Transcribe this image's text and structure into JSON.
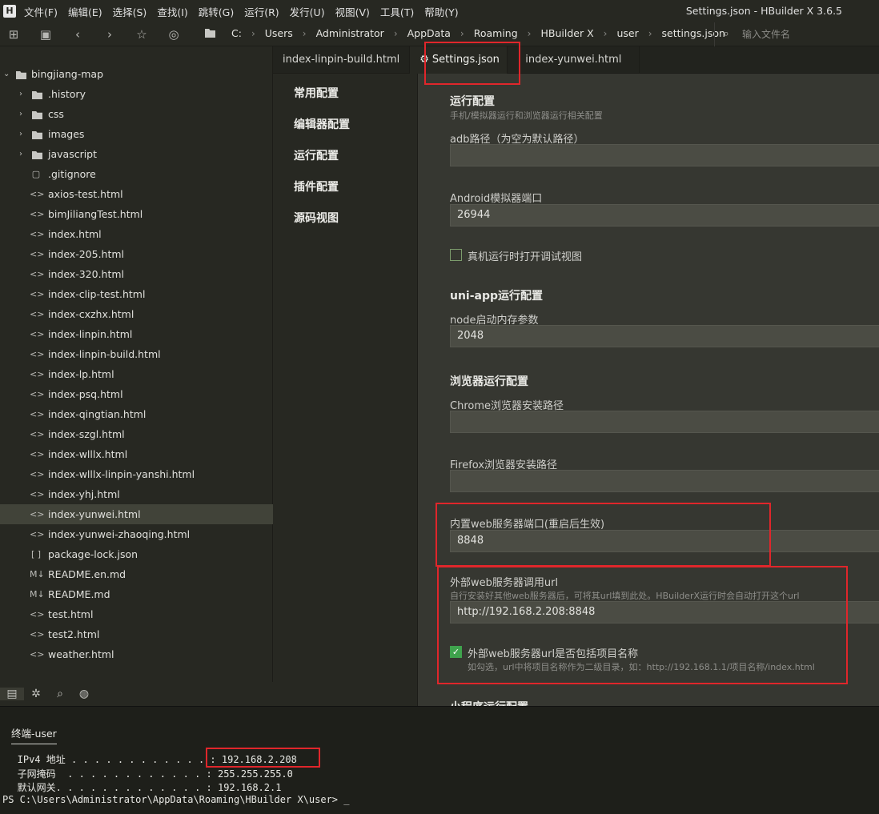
{
  "app": {
    "logo": "H",
    "window_title": "Settings.json - HBuilder X 3.6.5"
  },
  "menu": [
    "文件(F)",
    "编辑(E)",
    "选择(S)",
    "查找(I)",
    "跳转(G)",
    "运行(R)",
    "发行(U)",
    "视图(V)",
    "工具(T)",
    "帮助(Y)"
  ],
  "breadcrumb": [
    "C:",
    "Users",
    "Administrator",
    "AppData",
    "Roaming",
    "HBuilder X",
    "user",
    "settings.json"
  ],
  "file_search": {
    "placeholder": "输入文件名"
  },
  "sidebar": {
    "root": "bingjiang-map",
    "items": [
      {
        "label": ".history",
        "kind": "folder"
      },
      {
        "label": "css",
        "kind": "folder"
      },
      {
        "label": "images",
        "kind": "folder"
      },
      {
        "label": "javascript",
        "kind": "folder"
      },
      {
        "label": ".gitignore",
        "kind": "file",
        "icon": "file-icon"
      },
      {
        "label": "axios-test.html",
        "kind": "file",
        "icon": "html-icon"
      },
      {
        "label": "bimJiliangTest.html",
        "kind": "file",
        "icon": "html-icon"
      },
      {
        "label": "index.html",
        "kind": "file",
        "icon": "html-icon"
      },
      {
        "label": "index-205.html",
        "kind": "file",
        "icon": "html-icon"
      },
      {
        "label": "index-320.html",
        "kind": "file",
        "icon": "html-icon"
      },
      {
        "label": "index-clip-test.html",
        "kind": "file",
        "icon": "html-icon"
      },
      {
        "label": "index-cxzhx.html",
        "kind": "file",
        "icon": "html-icon"
      },
      {
        "label": "index-linpin.html",
        "kind": "file",
        "icon": "html-icon"
      },
      {
        "label": "index-linpin-build.html",
        "kind": "file",
        "icon": "html-icon"
      },
      {
        "label": "index-lp.html",
        "kind": "file",
        "icon": "html-icon"
      },
      {
        "label": "index-psq.html",
        "kind": "file",
        "icon": "html-icon"
      },
      {
        "label": "index-qingtian.html",
        "kind": "file",
        "icon": "html-icon"
      },
      {
        "label": "index-szgl.html",
        "kind": "file",
        "icon": "html-icon"
      },
      {
        "label": "index-wlllx.html",
        "kind": "file",
        "icon": "html-icon"
      },
      {
        "label": "index-wlllx-linpin-yanshi.html",
        "kind": "file",
        "icon": "html-icon"
      },
      {
        "label": "index-yhj.html",
        "kind": "file",
        "icon": "html-icon"
      },
      {
        "label": "index-yunwei.html",
        "kind": "file",
        "icon": "html-icon",
        "active": true
      },
      {
        "label": "index-yunwei-zhaoqing.html",
        "kind": "file",
        "icon": "html-icon"
      },
      {
        "label": "package-lock.json",
        "kind": "file",
        "icon": "json-icon"
      },
      {
        "label": "README.en.md",
        "kind": "file",
        "icon": "markdown-icon"
      },
      {
        "label": "README.md",
        "kind": "file",
        "icon": "markdown-icon"
      },
      {
        "label": "test.html",
        "kind": "file",
        "icon": "html-icon"
      },
      {
        "label": "test2.html",
        "kind": "file",
        "icon": "html-icon"
      },
      {
        "label": "weather.html",
        "kind": "file",
        "icon": "html-icon"
      }
    ],
    "bottom_icons": [
      "project-manager-icon",
      "debug-icon",
      "search-icon",
      "plugin-icon"
    ]
  },
  "tabs": [
    {
      "label": "index-linpin-build.html"
    },
    {
      "label": "Settings.json",
      "active": true,
      "icon": "gear-icon"
    },
    {
      "label": "index-yunwei.html"
    }
  ],
  "settings_nav": [
    "常用配置",
    "编辑器配置",
    "运行配置",
    "插件配置",
    "源码视图"
  ],
  "settings": {
    "run_config": {
      "title": "运行配置",
      "desc": "手机/模拟器运行和浏览器运行相关配置",
      "adb_label": "adb路径（为空为默认路径）",
      "adb_value": "",
      "android_port_label": "Android模拟器端口",
      "android_port_value": "26944",
      "debug_view_label": "真机运行时打开调试视图",
      "debug_view_checked": false
    },
    "uniapp_config": {
      "title": "uni-app运行配置",
      "node_mem_label": "node启动内存参数",
      "node_mem_value": "2048"
    },
    "browser_config": {
      "title": "浏览器运行配置",
      "chrome_label": "Chrome浏览器安装路径",
      "chrome_value": "",
      "firefox_label": "Firefox浏览器安装路径",
      "firefox_value": "",
      "web_port_label": "内置web服务器端口(重启后生效)",
      "web_port_value": "8848",
      "ext_url_label": "外部web服务器调用url",
      "ext_url_desc": "自行安装好其他web服务器后，可将其url填到此处。HBuilderX运行时会自动打开这个url",
      "ext_url_value": "http://192.168.2.208:8848",
      "include_project_label": "外部web服务器url是否包括项目名称",
      "include_project_desc": "如勾选，url中将项目名称作为二级目录，如：http://192.168.1.1/项目名称/index.html",
      "include_project_checked": true
    },
    "miniprogram_title": "小程序运行配置"
  },
  "terminal": {
    "tab_label": "终端-user",
    "lines": [
      {
        "key": "   IPv4 地址 . . . . . . . . . . . . ",
        "value": ": 192.168.2.208"
      },
      {
        "key": "   子网掩码  . . . . . . . . . . . . ",
        "value": ": 255.255.255.0"
      },
      {
        "key": "   默认网关. . . . . . . . . . . . . ",
        "value": ": 192.168.2.1"
      }
    ],
    "prompt": "PS C:\\Users\\Administrator\\AppData\\Roaming\\HBuilder X\\user> _"
  },
  "colors": {
    "background": "#272822",
    "settings_panel": "#363731",
    "highlight_box": "#e0262b",
    "checkbox_checked": "#3fa34d"
  }
}
